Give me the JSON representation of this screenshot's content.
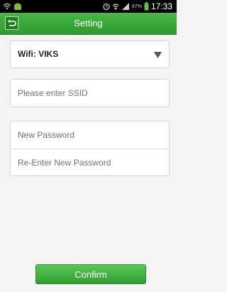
{
  "status_bar": {
    "time": "17:33",
    "battery_percent": "87%",
    "icons": [
      "wifi-icon",
      "android-icon",
      "alarm-icon",
      "wifi-signal-icon",
      "cell-signal-icon",
      "battery-icon"
    ]
  },
  "app_bar": {
    "title": "Setting",
    "back_icon": "back-arrow-icon"
  },
  "wifi_select": {
    "label": "Wifi: VIKS",
    "icon": "dropdown-triangle-icon"
  },
  "ssid_field": {
    "value": "",
    "placeholder": "Please enter SSID"
  },
  "new_password_field": {
    "value": "",
    "placeholder": "New Password"
  },
  "reenter_password_field": {
    "value": "",
    "placeholder": "Re-Enter New Password"
  },
  "confirm_button": {
    "label": "Confirm"
  },
  "colors": {
    "accent_green": "#3aab3a",
    "status_bar": "#000000",
    "background": "#f4f4f4"
  }
}
